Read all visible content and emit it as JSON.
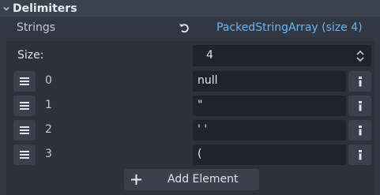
{
  "section": {
    "title": "Delimiters",
    "expand_icon": "chevron-down-icon"
  },
  "property": {
    "label": "Strings",
    "revert_icon": "revert-icon",
    "value": "PackedStringArray (size 4)"
  },
  "array": {
    "size_label": "Size:",
    "size_value": "4",
    "elements": [
      {
        "index": "0",
        "value": "null"
      },
      {
        "index": "1",
        "value": "\""
      },
      {
        "index": "2",
        "value": "' '"
      },
      {
        "index": "3",
        "value": "("
      }
    ],
    "add_label": "Add Element"
  },
  "colors": {
    "accent_link": "#6cb4f2",
    "background": "#313743",
    "panel": "#2c313a",
    "field": "#1f232b"
  }
}
